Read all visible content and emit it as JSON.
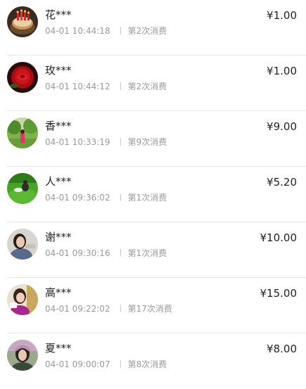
{
  "records": [
    {
      "name": "花***",
      "time": "04-01 10:44:18",
      "count": "第2次消费",
      "amount": "¥1.00",
      "avatar": "cake-avatar-icon"
    },
    {
      "name": "玫***",
      "time": "04-01 10:44:12",
      "count": "第2次消费",
      "amount": "¥1.00",
      "avatar": "rose-avatar-icon"
    },
    {
      "name": "香***",
      "time": "04-01 10:33:19",
      "count": "第9次消费",
      "amount": "¥9.00",
      "avatar": "park-avatar-icon"
    },
    {
      "name": "人***",
      "time": "04-01 09:36:02",
      "count": "第1次消费",
      "amount": "¥5.20",
      "avatar": "grass-avatar-icon"
    },
    {
      "name": "谢***",
      "time": "04-01 09:30:16",
      "count": "第1次消费",
      "amount": "¥10.00",
      "avatar": "woman-avatar-icon"
    },
    {
      "name": "高***",
      "time": "04-01 09:22:02",
      "count": "第17次消费",
      "amount": "¥15.00",
      "avatar": "girl-avatar-icon"
    },
    {
      "name": "夏***",
      "time": "04-01 09:00:07",
      "count": "第8次消费",
      "amount": "¥8.00",
      "avatar": "portrait-avatar-icon"
    }
  ]
}
